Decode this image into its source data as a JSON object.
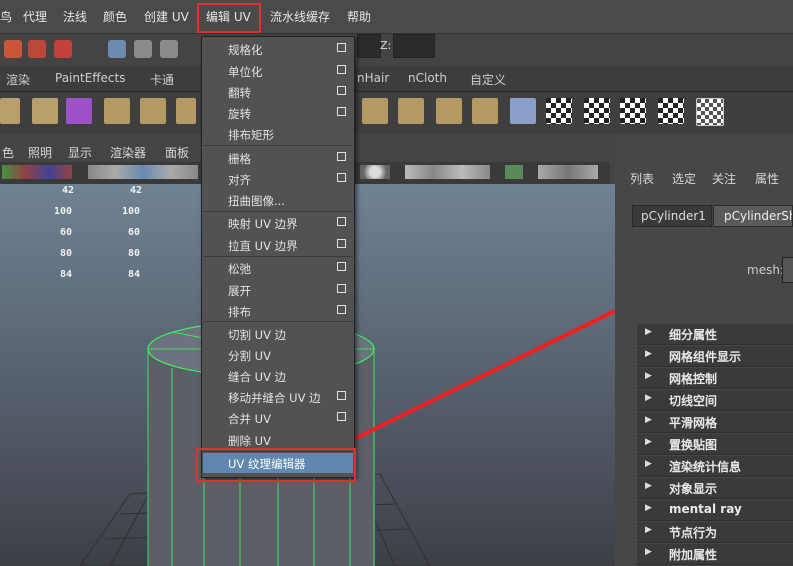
{
  "menubar": {
    "items": [
      "鸟",
      "代理",
      "法线",
      "颜色",
      "创建 UV",
      "编辑 UV",
      "流水线缓存",
      "帮助"
    ]
  },
  "toolbar": {
    "z_label": "Z:"
  },
  "shelf_tabs": [
    "渲染",
    "PaintEffects",
    "卡通",
    "nHair",
    "nCloth",
    "自定义"
  ],
  "viewport_menu": [
    "色",
    "照明",
    "显示",
    "渲染器",
    "面板"
  ],
  "stats": {
    "col1": [
      "42",
      "100",
      "60",
      "80",
      "84"
    ],
    "col2": [
      "42",
      "100",
      "60",
      "80",
      "84"
    ]
  },
  "edit_uv_menu": {
    "items": [
      {
        "label": "规格化",
        "option": true
      },
      {
        "label": "单位化",
        "option": true
      },
      {
        "label": "翻转",
        "option": true
      },
      {
        "label": "旋转",
        "option": true
      },
      {
        "label": "排布矩形",
        "option": false
      },
      {
        "label": "栅格",
        "option": true
      },
      {
        "label": "对齐",
        "option": true
      },
      {
        "label": "扭曲图像...",
        "option": false
      },
      {
        "label": "映射 UV 边界",
        "option": true
      },
      {
        "label": "拉直 UV 边界",
        "option": true
      },
      {
        "label": "松弛",
        "option": true
      },
      {
        "label": "展开",
        "option": true
      },
      {
        "label": "排布",
        "option": true
      },
      {
        "label": "切割 UV 边",
        "option": false
      },
      {
        "label": "分割 UV",
        "option": false
      },
      {
        "label": "缝合 UV 边",
        "option": false
      },
      {
        "label": "移动并缝合 UV 边",
        "option": true
      },
      {
        "label": "合并 UV",
        "option": true
      },
      {
        "label": "删除 UV",
        "option": false
      },
      {
        "label": "UV 纹理编辑器",
        "option": false
      }
    ]
  },
  "right_panel": {
    "tabs": [
      "列表",
      "选定",
      "关注",
      "属性"
    ],
    "node_tabs": [
      "pCylinder1",
      "pCylinderSh"
    ],
    "mesh_label": "mesh:",
    "sections": [
      "细分属性",
      "网格组件显示",
      "网格控制",
      "切线空间",
      "平滑网格",
      "置换贴图",
      "渲染统计信息",
      "对象显示",
      "mental ray",
      "节点行为",
      "附加属性"
    ]
  },
  "colors": {
    "highlight_red": "#e03030",
    "selected_blue": "#5f87b0",
    "wire_green": "#3cf05a"
  }
}
